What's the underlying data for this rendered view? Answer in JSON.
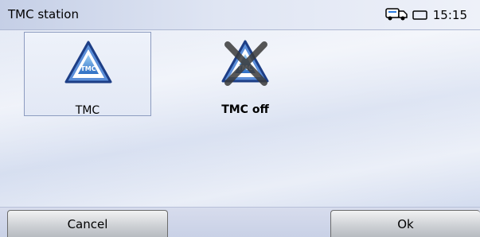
{
  "title": "TMC station",
  "status": {
    "clock": "15:15",
    "traffic_icon": "truck-icon",
    "battery_icon": "battery-icon"
  },
  "tiles": [
    {
      "label": "TMC",
      "icon_text": "TMC",
      "selected": true
    },
    {
      "label": "TMC off",
      "icon_text": "TMC",
      "selected": false
    }
  ],
  "buttons": {
    "cancel": "Cancel",
    "ok": "Ok"
  }
}
